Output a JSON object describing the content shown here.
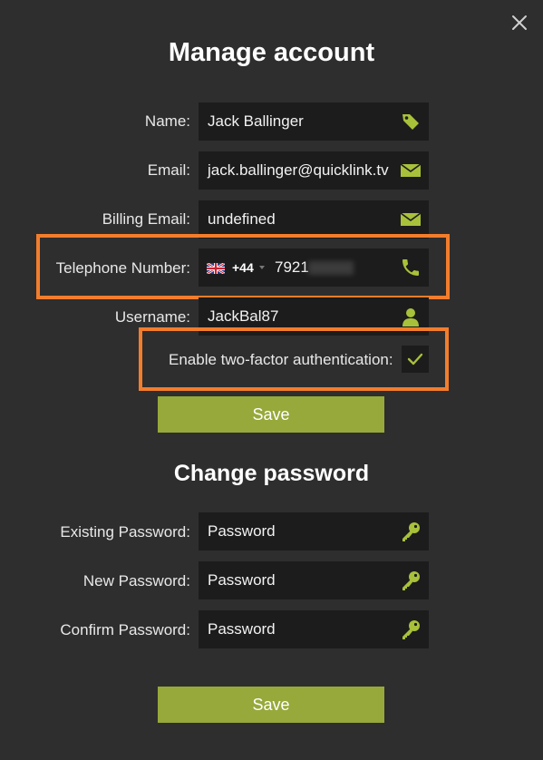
{
  "dialog": {
    "title": "Manage account",
    "close_icon": "close-icon"
  },
  "account": {
    "name": {
      "label": "Name:",
      "value": "Jack Ballinger",
      "icon": "tag-icon"
    },
    "email": {
      "label": "Email:",
      "value": "jack.ballinger@quicklink.tv",
      "icon": "envelope-icon"
    },
    "billing_email": {
      "label": "Billing Email:",
      "value": "undefined",
      "icon": "envelope-icon"
    },
    "telephone": {
      "label": "Telephone Number:",
      "flag": "uk-flag-icon",
      "country_code": "+44",
      "number_visible": "7921",
      "icon": "phone-icon"
    },
    "username": {
      "label": "Username:",
      "value": "JackBal87",
      "icon": "user-icon"
    },
    "two_factor": {
      "label": "Enable two-factor authentication:",
      "checked": true
    },
    "save_label": "Save"
  },
  "password": {
    "title": "Change password",
    "existing": {
      "label": "Existing Password:",
      "placeholder": "Password",
      "icon": "key-icon"
    },
    "new": {
      "label": "New Password:",
      "placeholder": "Password",
      "icon": "key-icon"
    },
    "confirm": {
      "label": "Confirm Password:",
      "placeholder": "Password",
      "icon": "key-icon"
    },
    "save_label": "Save"
  },
  "colors": {
    "background": "#2e2e2e",
    "field": "#1c1c1c",
    "accent": "#96a93a",
    "icon": "#a8c13a",
    "highlight": "#f37d2c"
  }
}
